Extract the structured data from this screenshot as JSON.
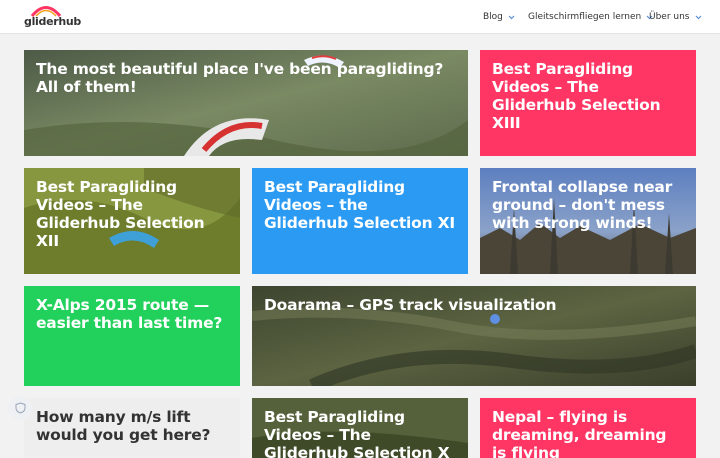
{
  "header": {
    "logo_text": "gliderhub",
    "nav": [
      {
        "label": "Blog"
      },
      {
        "label": "Gleitschirmfliegen lernen"
      },
      {
        "label": "Über uns"
      }
    ]
  },
  "colors": {
    "pink": "#ff3564",
    "blue": "#2b9af3",
    "green": "#22d15c",
    "light_gray": "#eeeeee"
  },
  "cards": [
    {
      "title": "The most beautiful place I've been paragliding? All of them!"
    },
    {
      "title": "Best Paragliding Videos – The Gliderhub Selection XIII"
    },
    {
      "title": "Best Paragliding Videos – The Gliderhub Selection XII"
    },
    {
      "title": "Best Paragliding Videos – the Gliderhub Selection XI"
    },
    {
      "title": "Frontal collapse near ground – don't mess with strong winds!"
    },
    {
      "title": "X-Alps 2015 route — easier than last time?"
    },
    {
      "title": "Doarama – GPS track visualization"
    },
    {
      "title": "How many m/s lift would you get here?"
    },
    {
      "title": "Best Paragliding Videos – The Gliderhub Selection X"
    },
    {
      "title": "Nepal – flying is dreaming, dreaming is flying"
    }
  ]
}
